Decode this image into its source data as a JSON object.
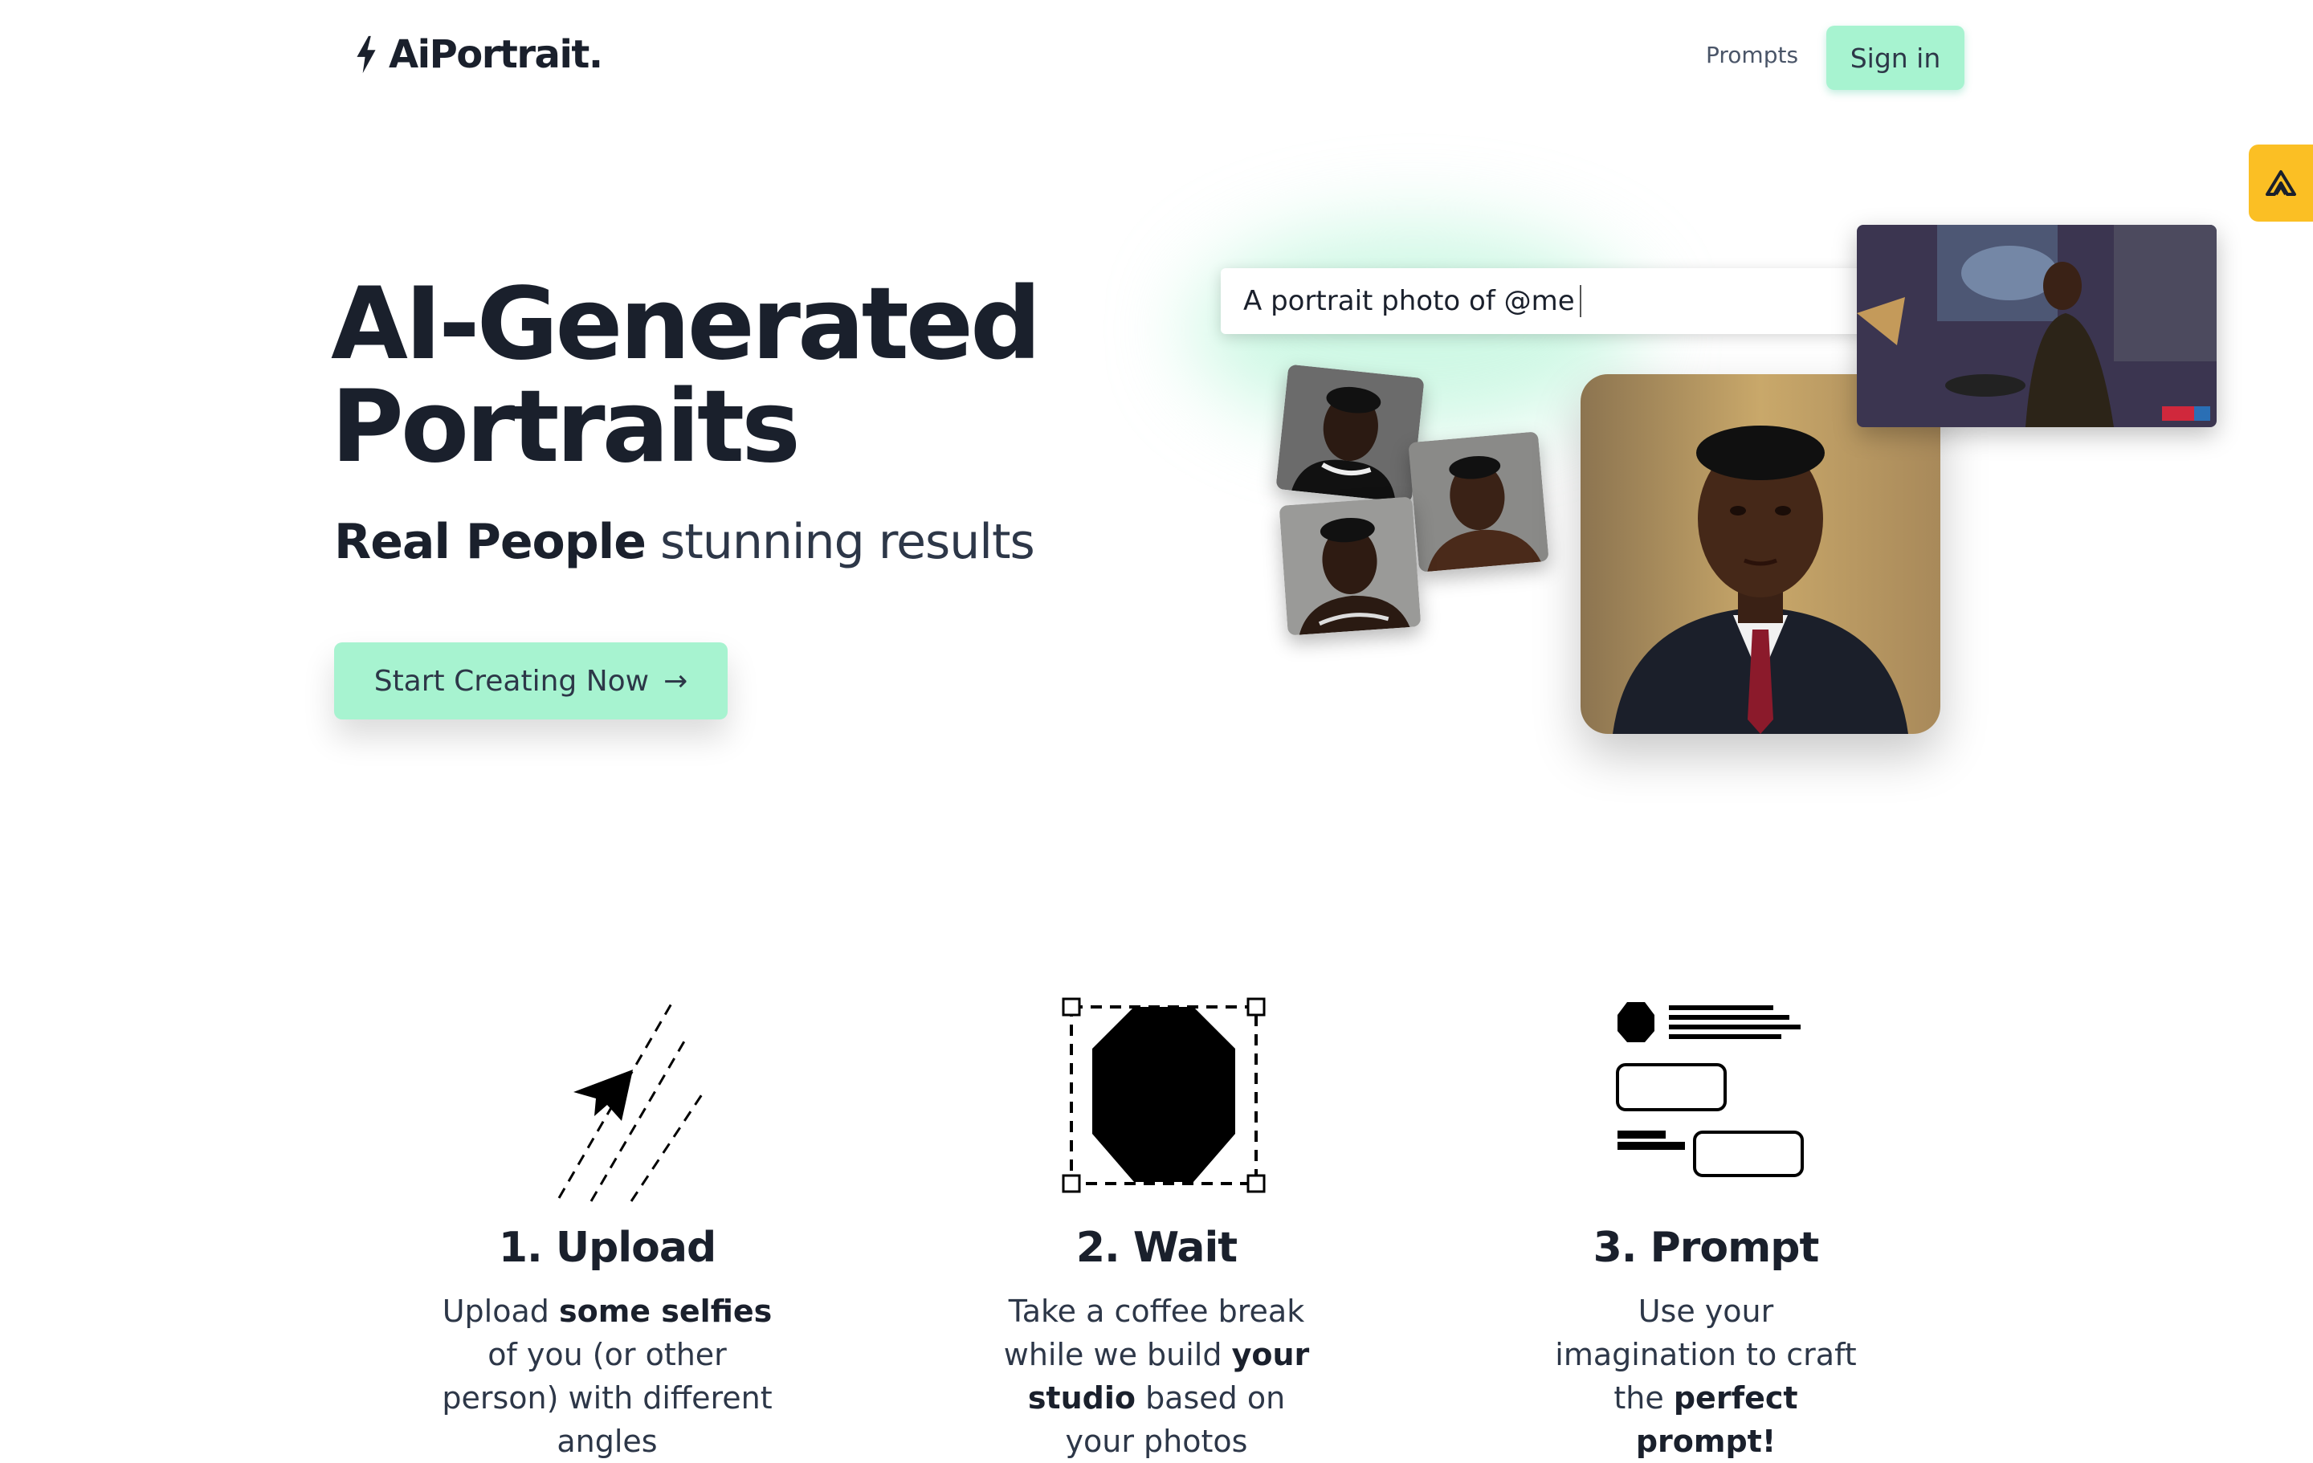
{
  "header": {
    "logo_text": "AiPortrait.",
    "nav_prompts": "Prompts",
    "signin_label": "Sign in"
  },
  "hero": {
    "title_line1": "AI-Generated",
    "title_line2": "Portraits",
    "subtitle_bold": "Real People",
    "subtitle_rest": " stunning results",
    "cta_label": "Start Creating Now",
    "cta_arrow": "→",
    "prompt_text": "A portrait photo of @me"
  },
  "steps": [
    {
      "title": "1. Upload",
      "desc_parts": [
        "Upload ",
        "some selfies",
        " of you (or other person) with different angles"
      ]
    },
    {
      "title": "2. Wait",
      "desc_parts": [
        "Take a coffee break while we build ",
        "your studio",
        " based on your photos"
      ]
    },
    {
      "title": "3. Prompt",
      "desc_parts": [
        "Use your imagination to craft the ",
        "perfect prompt!",
        ""
      ]
    }
  ],
  "colors": {
    "accent_green": "#a7f3d0",
    "side_tab": "#fbbf24",
    "text_dark": "#1a202c"
  },
  "icons": [
    "bolt-icon",
    "arrow-right-icon",
    "paper-plane-icon",
    "octagon-selection-icon",
    "prompt-blocks-icon",
    "side-widget-icon"
  ]
}
